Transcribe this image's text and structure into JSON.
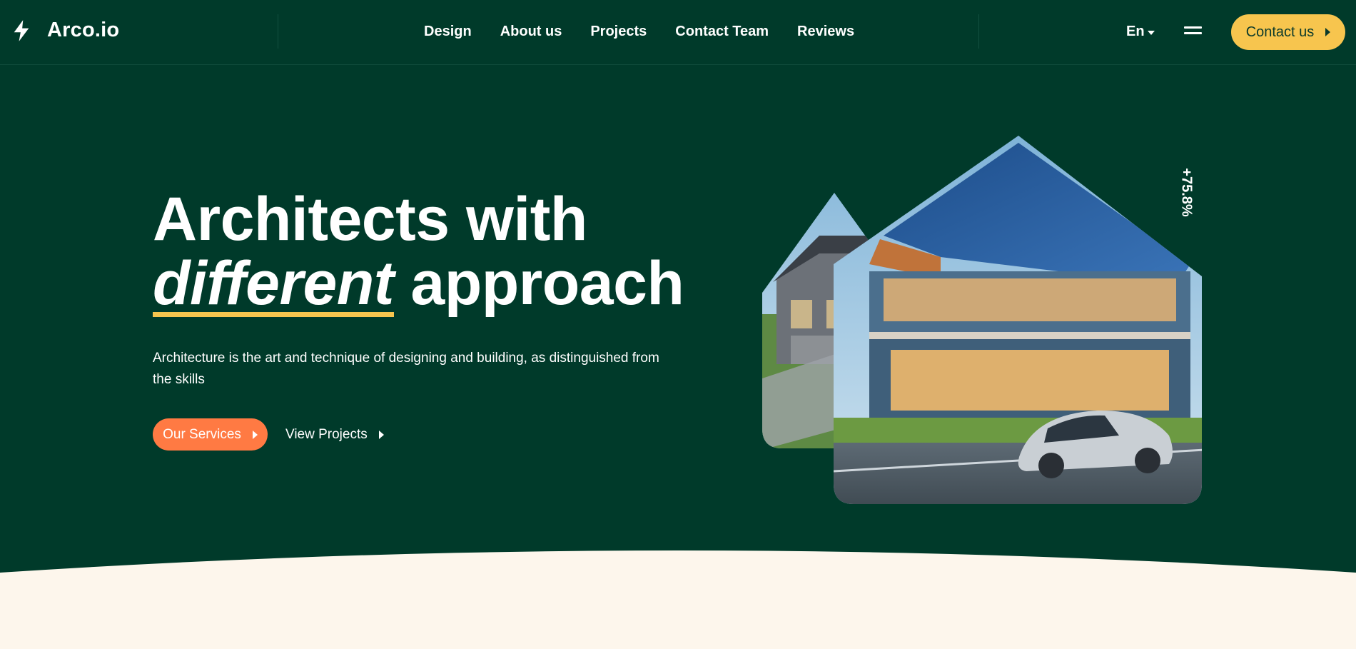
{
  "brand": {
    "name": "Arco.io"
  },
  "nav": {
    "items": [
      {
        "label": "Design"
      },
      {
        "label": "About us"
      },
      {
        "label": "Projects"
      },
      {
        "label": "Contact Team"
      },
      {
        "label": "Reviews"
      }
    ]
  },
  "header": {
    "language": "En",
    "contact_label": "Contact us"
  },
  "hero": {
    "title_line1": "Architects with",
    "title_emphasis": "different",
    "title_rest": "approach",
    "description": "Architecture is the art and technique of designing and building, as distinguished from the skills",
    "primary_button": "Our Services",
    "secondary_button": "View Projects",
    "stat": "+75.8%"
  },
  "colors": {
    "background": "#003a2a",
    "accent_yellow": "#f7c54e",
    "accent_orange": "#ff7a43",
    "cream": "#fdf6ec"
  },
  "icons": {
    "logo": "lightning-bolt-icon",
    "menu": "hamburger-menu-icon",
    "caret": "caret-down-icon",
    "arrow": "triangle-right-icon"
  }
}
